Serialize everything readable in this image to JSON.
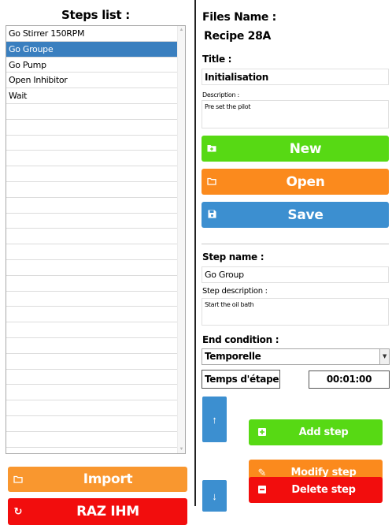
{
  "left": {
    "title": "Steps list :",
    "steps": [
      "Go Stirrer 150RPM",
      "Go Groupe",
      "Go Pump",
      "Open Inhibitor",
      "Wait"
    ],
    "selected_index": 1,
    "import_label": "Import",
    "raz_label": "RAZ IHM"
  },
  "file": {
    "files_name_label": "Files Name :",
    "files_name_value": "Recipe 28A",
    "title_label": "Title :",
    "title_value": "Initialisation",
    "description_label": "Description :",
    "description_value": "Pre set the pilot",
    "new_label": "New",
    "open_label": "Open",
    "save_label": "Save"
  },
  "step": {
    "name_label": "Step name :",
    "name_value": "Go Group",
    "desc_label": "Step description :",
    "desc_value": "Start the oil bath",
    "end_condition_label": "End condition :",
    "end_condition_value": "Temporelle",
    "temps_label": "Temps d'étape :",
    "temps_value": "00:01:00",
    "add_label": "Add step",
    "modify_label": "Modify step",
    "delete_label": "Delete step"
  },
  "colors": {
    "green": "#57d914",
    "orange": "#fb8a1d",
    "blue": "#3c8fd0",
    "red": "#f20d0d",
    "selection": "#3a7fbf"
  },
  "icons": {
    "new": "folder-plus-icon",
    "open": "folder-icon",
    "save": "floppy-disk-icon",
    "import": "folder-icon",
    "raz": "refresh-icon",
    "up": "arrow-up-icon",
    "down": "arrow-down-icon",
    "add": "plus-square-icon",
    "modify": "pencil-icon",
    "delete": "minus-square-icon"
  }
}
